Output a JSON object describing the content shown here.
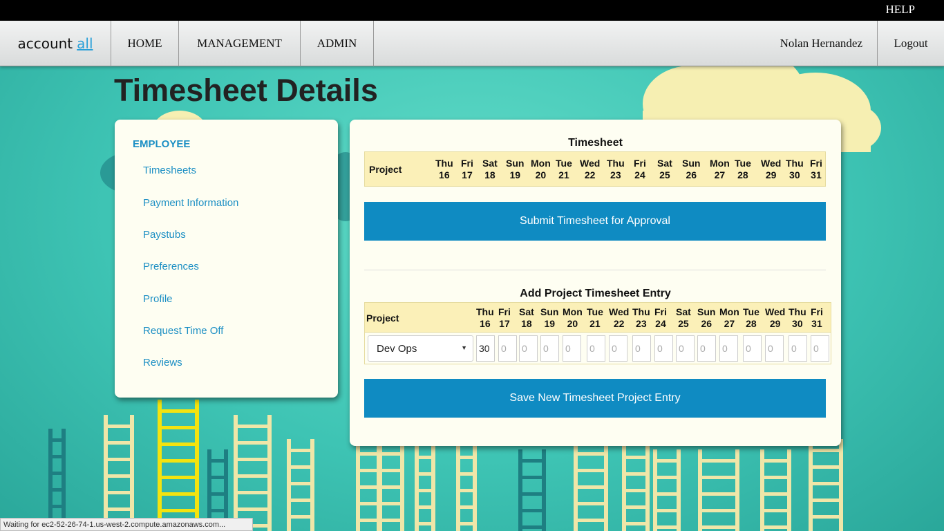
{
  "topbar": {
    "help": "HELP"
  },
  "nav": {
    "logo_main": "account",
    "logo_accent": "all",
    "home": "HOME",
    "management": "MANAGEMENT",
    "admin": "ADMIN",
    "user": "Nolan Hernandez",
    "logout": "Logout"
  },
  "page": {
    "title": "Timesheet Details"
  },
  "sidebar": {
    "heading": "EMPLOYEE",
    "items": [
      "Timesheets",
      "Payment Information",
      "Paystubs",
      "Preferences",
      "Profile",
      "Request Time Off",
      "Reviews"
    ]
  },
  "timesheet": {
    "title": "Timesheet",
    "project_header": "Project",
    "days": [
      {
        "dow": "Thu",
        "num": "16"
      },
      {
        "dow": "Fri",
        "num": "17"
      },
      {
        "dow": "Sat",
        "num": "18"
      },
      {
        "dow": "Sun",
        "num": "19"
      },
      {
        "dow": "Mon",
        "num": "20"
      },
      {
        "dow": "Tue",
        "num": "21"
      },
      {
        "dow": "Wed",
        "num": "22"
      },
      {
        "dow": "Thu",
        "num": "23"
      },
      {
        "dow": "Fri",
        "num": "24"
      },
      {
        "dow": "Sat",
        "num": "25"
      },
      {
        "dow": "Sun",
        "num": "26"
      },
      {
        "dow": "Mon",
        "num": "27"
      },
      {
        "dow": "Tue",
        "num": "28"
      },
      {
        "dow": "Wed",
        "num": "29"
      },
      {
        "dow": "Thu",
        "num": "30"
      },
      {
        "dow": "Fri",
        "num": "31"
      }
    ],
    "submit_label": "Submit Timesheet for Approval"
  },
  "entry": {
    "title": "Add Project Timesheet Entry",
    "project_header": "Project",
    "selected_project": "Dev Ops",
    "values": [
      "30",
      "",
      "",
      "",
      "",
      "",
      "",
      "",
      "",
      "",
      "",
      "",
      "",
      "",
      "",
      ""
    ],
    "placeholder": "0",
    "save_label": "Save New Timesheet Project Entry"
  },
  "status": {
    "text": "Waiting for ec2-52-26-74-1.us-west-2.compute.amazonaws.com..."
  }
}
